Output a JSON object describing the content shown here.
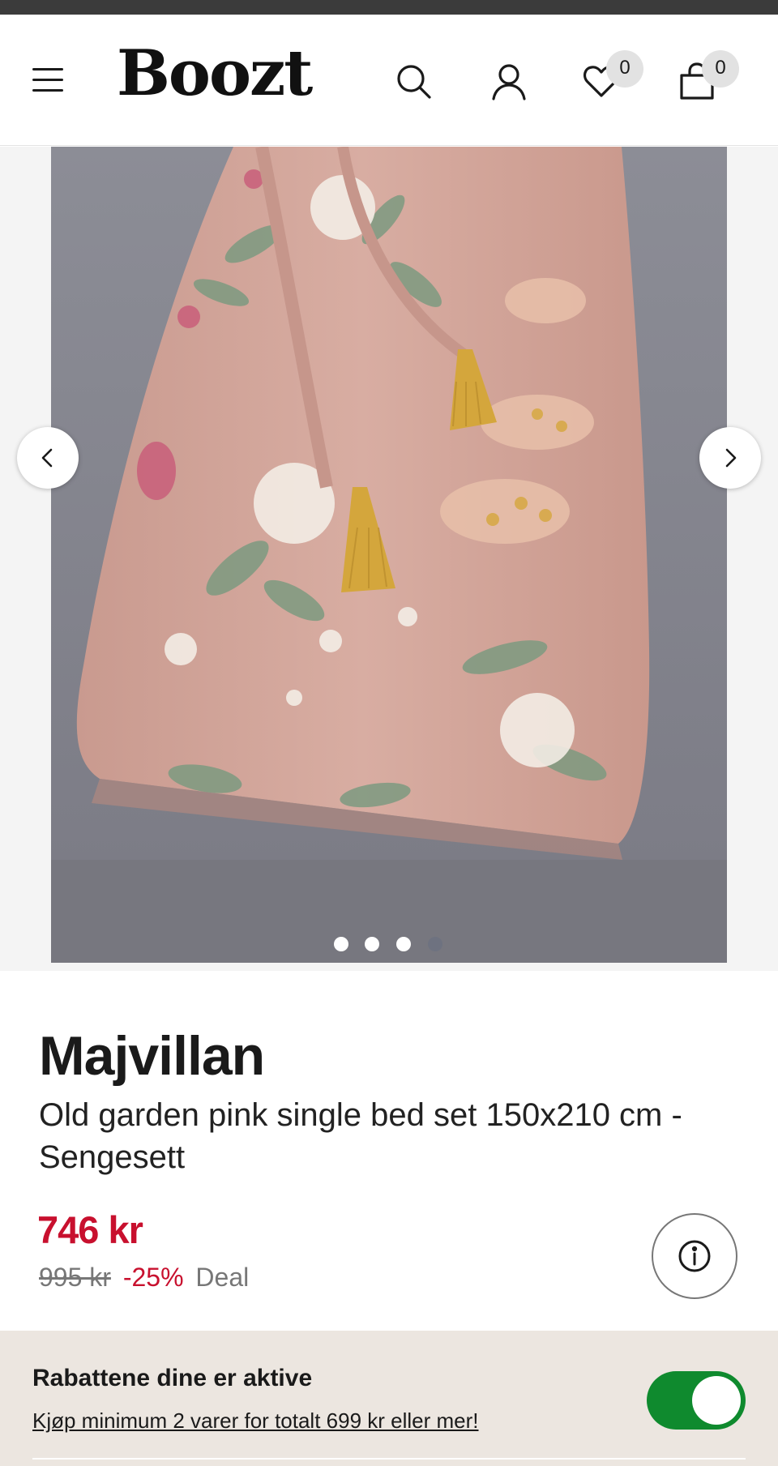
{
  "header": {
    "logo": "Boozt",
    "wishlist_count": "0",
    "cart_count": "0",
    "icons": [
      "menu-icon",
      "search-icon",
      "user-icon",
      "heart-icon",
      "bag-icon"
    ]
  },
  "gallery": {
    "image_alt": "Old garden pink single bed set pillow bag",
    "total_images": 4,
    "active_index": 3,
    "colors": {
      "fabric": "#d4a89c",
      "tassel": "#d4a63c"
    }
  },
  "product": {
    "brand": "Majvillan",
    "name": "Old garden pink single bed set 150x210 cm - Sengesett",
    "price": "746 kr",
    "old_price": "995 kr",
    "discount": "-25%",
    "deal_label": "Deal"
  },
  "promo": {
    "title": "Rabattene dine er aktive",
    "link": "Kjøp minimum 2 varer for totalt 699 kr eller mer!",
    "toggle_on": true
  },
  "colors": {
    "accent_red": "#c8102e",
    "toggle_green": "#0f8a2e",
    "promo_bg": "#ece6e0"
  }
}
